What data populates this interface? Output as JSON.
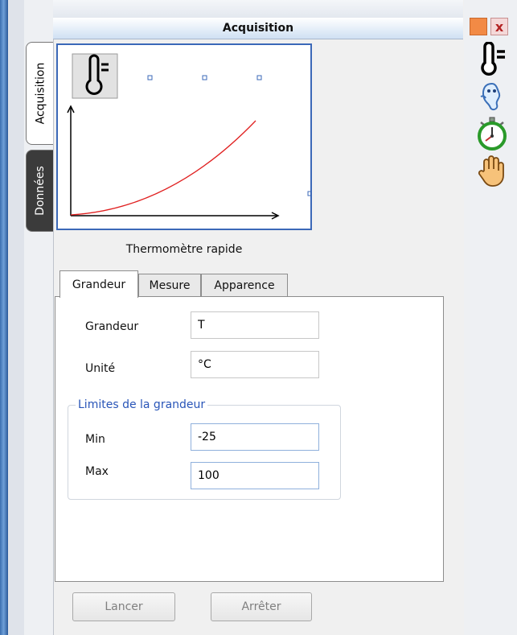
{
  "window": {
    "title": "Acquisition",
    "close_glyph": "x",
    "minimize_color": "#f28a45"
  },
  "side_tabs": [
    "Acquisition",
    "Données"
  ],
  "sensor": {
    "icon": "thermometer-icon",
    "name": "Thermomètre rapide"
  },
  "tabs": [
    "Grandeur",
    "Mesure",
    "Apparence"
  ],
  "grandeur": {
    "grandeur_label": "Grandeur",
    "grandeur_value": "T",
    "unite_label": "Unité",
    "unite_value": "°C",
    "limits_title": "Limites de la grandeur",
    "min_label": "Min",
    "min_value": "-25",
    "max_label": "Max",
    "max_value": "100"
  },
  "buttons": {
    "start": "Lancer",
    "stop": "Arrêter"
  },
  "toolbar": [
    "thermometer-icon",
    "ghost-icon",
    "stopwatch-icon",
    "hand-icon"
  ],
  "colors": {
    "accent": "#3b68b8",
    "curve": "#e02020",
    "group_title": "#2955b8"
  }
}
